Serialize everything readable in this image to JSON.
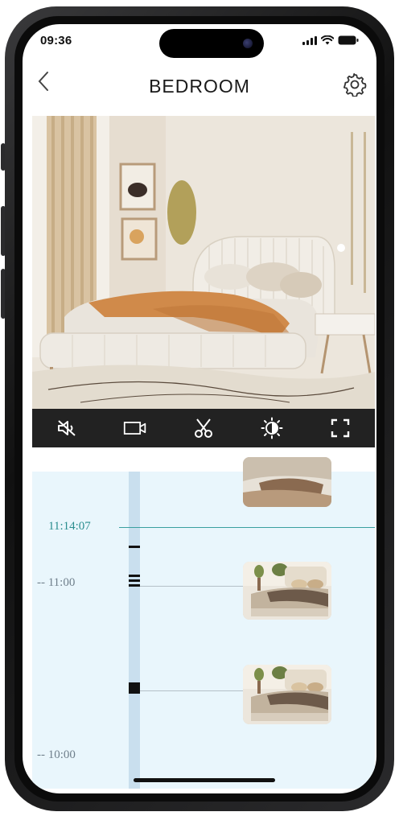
{
  "status_bar": {
    "time": "09:36",
    "signal_icon": "signal-bars-icon",
    "wifi_icon": "wifi-icon",
    "battery_icon": "battery-icon"
  },
  "header": {
    "title": "BEDROOM",
    "back_icon": "chevron-left-icon",
    "settings_icon": "gear-icon"
  },
  "video": {
    "scene": "bedroom-camera-feed"
  },
  "controls": [
    {
      "name": "mute",
      "icon": "speaker-muted-icon"
    },
    {
      "name": "record",
      "icon": "video-camera-icon"
    },
    {
      "name": "clip",
      "icon": "scissors-icon"
    },
    {
      "name": "night-mode",
      "icon": "day-night-icon"
    },
    {
      "name": "fullscreen",
      "icon": "fullscreen-icon"
    }
  ],
  "timeline": {
    "current_time": "11:14:07",
    "labels": [
      "-- 11:00",
      "-- 10:00"
    ]
  },
  "colors": {
    "accent": "#2a8d8f",
    "timeline_bg": "#e9f6fc",
    "track": "#c9dfee",
    "controls_bg": "#222222"
  }
}
